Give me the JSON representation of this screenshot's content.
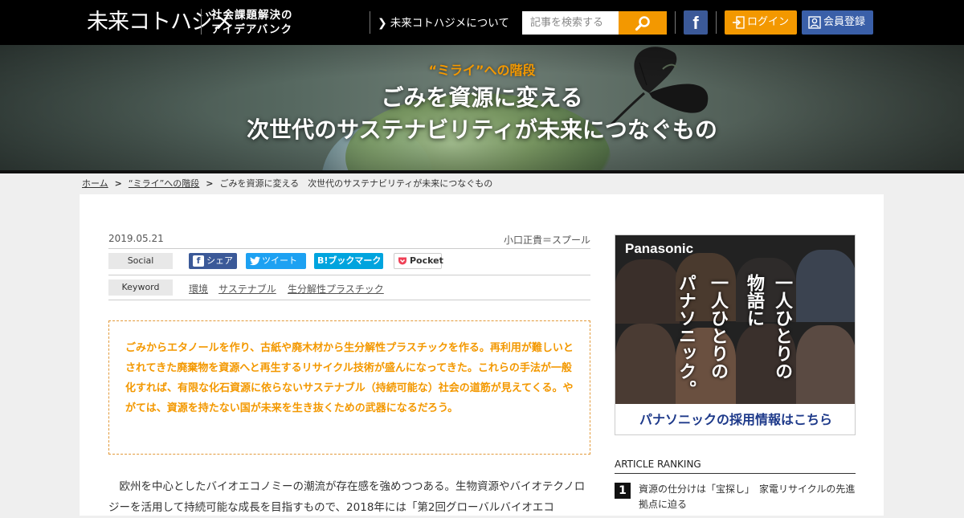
{
  "header": {
    "logo": "未来コトハジメ",
    "tagline_line1": "社会課題解決の",
    "tagline_line2": "アイデアバンク",
    "about_link": "未来コトハジメについて",
    "search_placeholder": "記事を検索する",
    "facebook_label": "f",
    "login_label": "ログイン",
    "register_label": "会員登録"
  },
  "hero": {
    "category": "“ミライ”への階段",
    "title_line1": "ごみを資源に変える",
    "title_line2": "次世代のサステナビリティが未来につなぐもの"
  },
  "breadcrumb": {
    "home": "ホーム",
    "sep": ">",
    "category": "“ミライ”への階段",
    "current": "ごみを資源に変える　次世代のサステナビリティが未来につなぐもの"
  },
  "article": {
    "date": "2019.05.21",
    "author": "小口正貴＝スプール",
    "social_label": "Social",
    "share_buttons": {
      "facebook": "シェア",
      "twitter": "ツイート",
      "hatena_icon": "B!",
      "hatena": "ブックマーク",
      "pocket": "Pocket"
    },
    "keyword_label": "Keyword",
    "keywords": [
      "環境",
      "サステナブル",
      "生分解性プラスチック"
    ],
    "lead": "ごみからエタノールを作り、古紙や廃木材から生分解性プラスチックを作る。再利用が難しいとされてきた廃棄物を資源へと再生するリサイクル技術が盛んになってきた。これらの手法が一般化すれば、有限な化石資源に依らないサステナブル（持続可能な）社会の道筋が見えてくる。やがては、資源を持たない国が未来を生き抜くための武器になるだろう。",
    "body": "欧州を中心としたバイオエコノミーの潮流が存在感を強めつつある。生物資源やバイオテクノロジーを活用して持続可能な成長を目指すもので、2018年には「第2回グローバルバイオエコ"
  },
  "ad": {
    "brand": "Panasonic",
    "vertical_right": "一人ひとりの",
    "vertical_mid": "物語に",
    "vertical_left": "一人ひとりの",
    "vertical_far": "パナソニック。",
    "cta": "パナソニックの採用情報はこちら"
  },
  "ranking": {
    "title": "ARTICLE RANKING",
    "items": [
      {
        "rank": "1",
        "text": "資源の仕分けは「宝探し」　家電リサイクルの先進拠点に迫る"
      }
    ]
  },
  "colors": {
    "accent": "#f39800",
    "register": "#3a5fa8",
    "facebook": "#3b5998",
    "twitter": "#1da1f2",
    "hatena": "#00a4de",
    "pocket": "#ef4056"
  }
}
